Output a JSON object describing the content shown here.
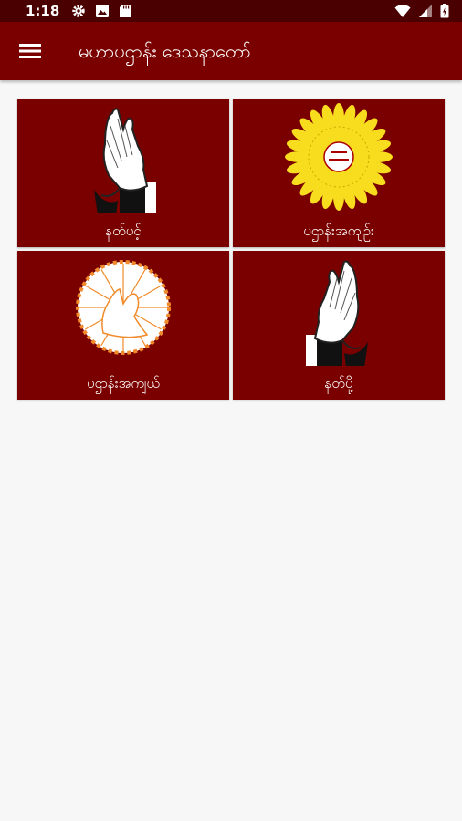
{
  "status_bar": {
    "time": "1:18",
    "icons_left": [
      "gear-icon",
      "photo-icon",
      "sd-card-icon"
    ],
    "icons_right": [
      "wifi-icon",
      "cell-signal-icon",
      "battery-icon"
    ]
  },
  "app_bar": {
    "menu_icon": "hamburger-menu-icon",
    "title": "မဟာပဌာန်း ဒေသနာတော်"
  },
  "tiles": [
    {
      "label": "နတ်ပင့်",
      "icon": "praying-hands-icon"
    },
    {
      "label": "ပဌာန်းအကျဉ်း",
      "icon": "yellow-emblem-icon"
    },
    {
      "label": "ပဌာန်းအကျယ်",
      "icon": "radiant-emblem-icon"
    },
    {
      "label": "နတ်ပို့",
      "icon": "praying-hands-mirrored-icon"
    }
  ],
  "colors": {
    "status_bar": "#4a0000",
    "app_bar": "#7a0000",
    "tile_background": "#7a0000",
    "page_background": "#f7f7f7",
    "emblem_yellow": "#f7dd1e",
    "emblem_orange": "#f08a2a"
  }
}
